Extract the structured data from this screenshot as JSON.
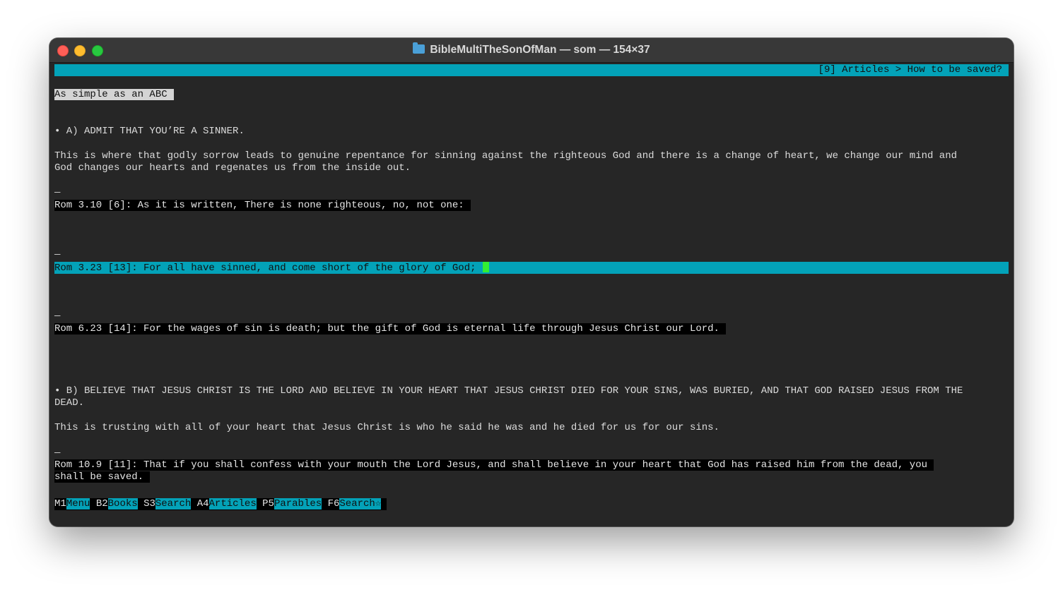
{
  "window": {
    "title": "BibleMultiTheSonOfMan — som — 154×37",
    "folder_icon": "folder-icon"
  },
  "status": {
    "breadcrumb": "[9] Articles > How to be saved?"
  },
  "content": {
    "heading": "As simple as an ABC",
    "point_a": "• A) ADMIT THAT YOU’RE A SINNER.",
    "para_a_1": "This is where that godly sorrow leads to genuine repentance for sinning against the righteous God and there is a change of heart, we change our mind and",
    "para_a_2": "God changes our hearts and regenates us from the inside out.",
    "separator": "—",
    "verse_1": "Rom 3.10 [6]: As it is written, There is none righteous, no, not one:",
    "verse_2": "Rom 3.23 [13]: For all have sinned, and come short of the glory of God;",
    "verse_3": "Rom 6.23 [14]: For the wages of sin is death; but the gift of God is eternal life through Jesus Christ our Lord.",
    "point_b_1": "• B) BELIEVE THAT JESUS CHRIST IS THE LORD AND BELIEVE IN YOUR HEART THAT JESUS CHRIST DIED FOR YOUR SINS, WAS BURIED, AND THAT GOD RAISED JESUS FROM THE",
    "point_b_2": "DEAD.",
    "para_b": "This is trusting with all of your heart that Jesus Christ is who he said he was and he died for us for our sins.",
    "verse_4_1": "Rom 10.9 [11]: That if you shall confess with your mouth the Lord Jesus, and shall believe in your heart that God has raised him from the dead, you",
    "verse_4_2": "shall be saved."
  },
  "function_keys": [
    {
      "key": "M1",
      "label": "Menu"
    },
    {
      "key": "B2",
      "label": "Books"
    },
    {
      "key": "S3",
      "label": "Search"
    },
    {
      "key": "A4",
      "label": "Articles"
    },
    {
      "key": "P5",
      "label": "Parables"
    },
    {
      "key": "F6",
      "label": "Search☆"
    }
  ],
  "colors": {
    "accent": "#03a2b8",
    "cursor": "#33ee33",
    "background": "#262626"
  }
}
